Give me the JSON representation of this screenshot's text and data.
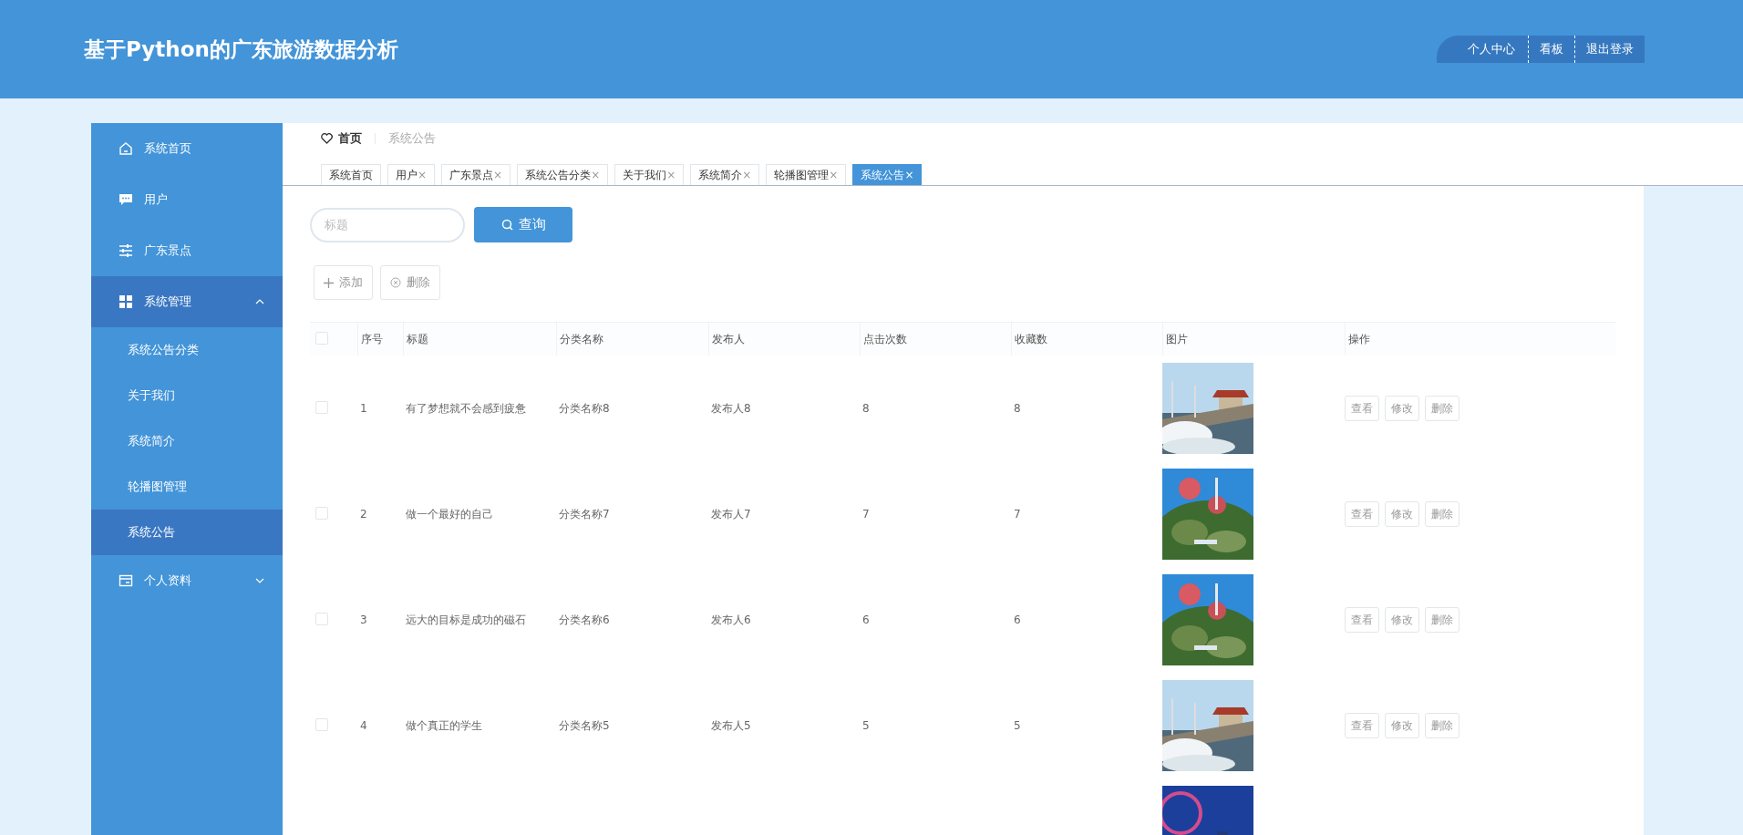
{
  "header": {
    "title": "基于Python的广东旅游数据分析",
    "actions": [
      {
        "label": "个人中心"
      },
      {
        "label": "看板"
      },
      {
        "label": "退出登录"
      }
    ]
  },
  "sidebar": {
    "items": [
      {
        "label": "系统首页",
        "selected": false
      },
      {
        "label": "用户",
        "selected": false
      },
      {
        "label": "广东景点",
        "selected": false
      },
      {
        "label": "系统管理",
        "selected": true,
        "expanded": true,
        "children": [
          {
            "label": "系统公告分类",
            "selected": false
          },
          {
            "label": "关于我们",
            "selected": false
          },
          {
            "label": "系统简介",
            "selected": false
          },
          {
            "label": "轮播图管理",
            "selected": false
          },
          {
            "label": "系统公告",
            "selected": true
          }
        ]
      },
      {
        "label": "个人资料",
        "selected": false,
        "expanded": false
      }
    ]
  },
  "breadcrumb": {
    "home": "首页",
    "current": "系统公告"
  },
  "tabs": [
    {
      "label": "系统首页",
      "selected": false
    },
    {
      "label": "用户",
      "close": "×",
      "selected": false
    },
    {
      "label": "广东景点",
      "close": "×",
      "selected": false
    },
    {
      "label": "系统公告分类",
      "close": "×",
      "selected": false
    },
    {
      "label": "关于我们",
      "close": "×",
      "selected": false
    },
    {
      "label": "系统简介",
      "close": "×",
      "selected": false
    },
    {
      "label": "轮播图管理",
      "close": "×",
      "selected": false
    },
    {
      "label": "系统公告",
      "close": "×",
      "selected": true
    }
  ],
  "search": {
    "placeholder": "标题",
    "button": "查询"
  },
  "toolbar": {
    "add": "添加",
    "delete": "删除"
  },
  "table": {
    "header_checked": false,
    "columns": [
      "序号",
      "标题",
      "分类名称",
      "发布人",
      "点击次数",
      "收藏数",
      "图片",
      "操作"
    ],
    "rows": [
      {
        "checked": false,
        "cells": [
          "1",
          "有了梦想就不会感到疲惫",
          "分类名称8",
          "发布人8",
          "8",
          "8"
        ],
        "image": {
          "kind": "picture"
        },
        "actions": [
          "查看",
          "修改",
          "删除"
        ]
      },
      {
        "checked": false,
        "cells": [
          "2",
          "做一个最好的自己",
          "分类名称7",
          "发布人7",
          "7",
          "7"
        ],
        "image": {
          "kind": "picture"
        },
        "actions": [
          "查看",
          "修改",
          "删除"
        ]
      },
      {
        "checked": false,
        "cells": [
          "3",
          "远大的目标是成功的磁石",
          "分类名称6",
          "发布人6",
          "6",
          "6"
        ],
        "image": {
          "kind": "picture"
        },
        "actions": [
          "查看",
          "修改",
          "删除"
        ]
      },
      {
        "checked": false,
        "cells": [
          "4",
          "做个真正的学生",
          "分类名称5",
          "发布人5",
          "5",
          "5"
        ],
        "image": {
          "kind": "picture"
        },
        "actions": [
          "查看",
          "修改",
          "删除"
        ]
      },
      {
        "image": {
          "kind": "picture"
        }
      }
    ]
  }
}
